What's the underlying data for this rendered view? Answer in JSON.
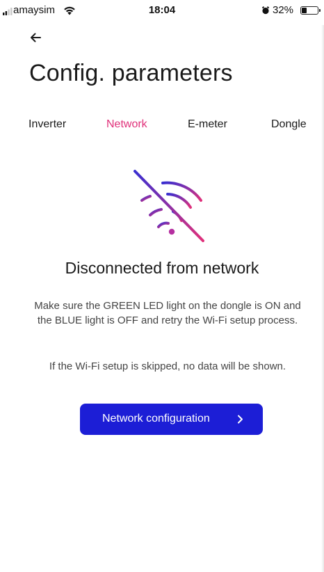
{
  "status_bar": {
    "carrier": "amaysim",
    "time": "18:04",
    "battery_percent": "32%",
    "battery_level": 0.32
  },
  "header": {
    "title": "Config. parameters"
  },
  "tabs": [
    {
      "label": "Inverter",
      "active": false
    },
    {
      "label": "Network",
      "active": true
    },
    {
      "label": "E-meter",
      "active": false
    },
    {
      "label": "Dongle",
      "active": false
    }
  ],
  "message": {
    "title": "Disconnected from network",
    "body": "Make sure the GREEN LED light on the dongle is ON and the BLUE light is OFF and retry the Wi-Fi setup process.",
    "note": "If the Wi-Fi setup is skipped, no data will be shown."
  },
  "actions": {
    "network_config_label": "Network configuration"
  },
  "icons": {
    "back": "arrow-left-icon",
    "illustration": "wifi-off-icon",
    "button_chevron": "chevron-right-icon"
  },
  "colors": {
    "accent": "#e0307a",
    "primary_button": "#1c1ed6",
    "icon_gradient_start": "#3a2fd0",
    "icon_gradient_end": "#e0307a"
  }
}
